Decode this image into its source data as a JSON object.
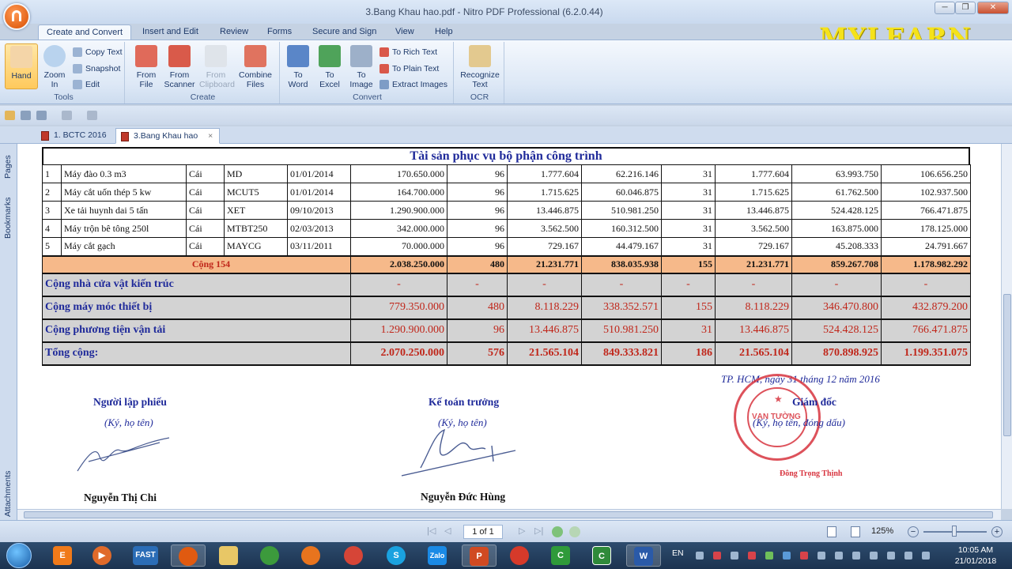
{
  "window": {
    "title": "3.Bang Khau hao.pdf - Nitro PDF Professional (6.2.0.44)",
    "minimize": "─",
    "restore": "❐",
    "close": "✕"
  },
  "ribbon_tabs": [
    "Create and Convert",
    "Insert and Edit",
    "Review",
    "Forms",
    "Secure and Sign",
    "View",
    "Help"
  ],
  "ribbon": {
    "tools": {
      "label": "Tools",
      "hand": "Hand",
      "zoom_in_1": "Zoom",
      "zoom_in_2": "In",
      "copy_text": "Copy Text",
      "snapshot": "Snapshot",
      "edit": "Edit"
    },
    "create": {
      "label": "Create",
      "from_file_1": "From",
      "from_file_2": "File",
      "from_scanner_1": "From",
      "from_scanner_2": "Scanner",
      "from_clipboard_1": "From",
      "from_clipboard_2": "Clipboard",
      "combine_1": "Combine",
      "combine_2": "Files"
    },
    "convert": {
      "label": "Convert",
      "to_word_1": "To",
      "to_word_2": "Word",
      "to_excel_1": "To",
      "to_excel_2": "Excel",
      "to_image_1": "To",
      "to_image_2": "Image",
      "to_rich": "To Rich Text",
      "to_plain": "To Plain Text",
      "extract": "Extract Images"
    },
    "ocr": {
      "label": "OCR",
      "recognize_1": "Recognize",
      "recognize_2": "Text"
    }
  },
  "watermark": "MYLEARN",
  "doc_tabs": [
    "1. BCTC 2016",
    "3.Bang Khau hao"
  ],
  "doc_tab_close": "×",
  "side_panels": [
    "Pages",
    "Bookmarks",
    "Attachments"
  ],
  "document": {
    "title": "Tài sản phục vụ bộ phận công trình",
    "rows": [
      [
        "1",
        "Máy đào 0.3 m3",
        "Cái",
        "MD",
        "01/01/2014",
        "170.650.000",
        "96",
        "1.777.604",
        "62.216.146",
        "31",
        "1.777.604",
        "63.993.750",
        "106.656.250"
      ],
      [
        "2",
        "Máy cắt uốn thép 5 kw",
        "Cái",
        "MCUT5",
        "01/01/2014",
        "164.700.000",
        "96",
        "1.715.625",
        "60.046.875",
        "31",
        "1.715.625",
        "61.762.500",
        "102.937.500"
      ],
      [
        "3",
        "Xe tải huynh dai 5 tấn",
        "Cái",
        "XET",
        "09/10/2013",
        "1.290.900.000",
        "96",
        "13.446.875",
        "510.981.250",
        "31",
        "13.446.875",
        "524.428.125",
        "766.471.875"
      ],
      [
        "4",
        "Máy trộn bê tông 250l",
        "Cái",
        "MTBT250",
        "02/03/2013",
        "342.000.000",
        "96",
        "3.562.500",
        "160.312.500",
        "31",
        "3.562.500",
        "163.875.000",
        "178.125.000"
      ],
      [
        "5",
        "Máy cắt gạch",
        "Cái",
        "MAYCG",
        "03/11/2011",
        "70.000.000",
        "96",
        "729.167",
        "44.479.167",
        "31",
        "729.167",
        "45.208.333",
        "24.791.667"
      ]
    ],
    "subtotal": {
      "label": "Cộng 154",
      "values": [
        "2.038.250.000",
        "480",
        "21.231.771",
        "838.035.938",
        "155",
        "21.231.771",
        "859.267.708",
        "1.178.982.292"
      ]
    },
    "groups": [
      {
        "label": "Cộng nhà cửa vật kiến trúc",
        "values": [
          "-",
          "-",
          "-",
          "-",
          "-",
          "-",
          "-",
          "-"
        ]
      },
      {
        "label": "Cộng máy móc thiết bị",
        "values": [
          "779.350.000",
          "480",
          "8.118.229",
          "338.352.571",
          "155",
          "8.118.229",
          "346.470.800",
          "432.879.200"
        ]
      },
      {
        "label": "Cộng phương tiện vận tải",
        "values": [
          "1.290.900.000",
          "96",
          "13.446.875",
          "510.981.250",
          "31",
          "13.446.875",
          "524.428.125",
          "766.471.875"
        ]
      }
    ],
    "total": {
      "label": "Tổng cộng:",
      "values": [
        "2.070.250.000",
        "576",
        "21.565.104",
        "849.333.821",
        "186",
        "21.565.104",
        "870.898.925",
        "1.199.351.075"
      ]
    },
    "date_line": "TP. HCM, ngày 31 tháng 12 năm 2016",
    "signers": [
      {
        "title": "Người lập phiếu",
        "note": "(Ký, họ tên)",
        "name": "Nguyễn Thị Chi"
      },
      {
        "title": "Kế toán trưởng",
        "note": "(Ký, họ tên)",
        "name": "Nguyễn Đức Hùng"
      },
      {
        "title": "Giám đốc",
        "note": "(Ký, họ tên, đóng dấu)",
        "name": "Đông Trọng Thịnh"
      }
    ],
    "stamp_name": "VẠN TƯỜNG"
  },
  "status": {
    "page": "1 of 1",
    "zoom": "125%"
  },
  "taskbar": {
    "lang": "EN",
    "time": "10:05 AM",
    "date": "21/01/2018"
  },
  "colors": {
    "accent": "#1f2a9a",
    "red": "#c0261a",
    "subtotal_bg": "#f6b98a",
    "group_bg": "#d3d3d3",
    "stamp": "#d8343f"
  }
}
